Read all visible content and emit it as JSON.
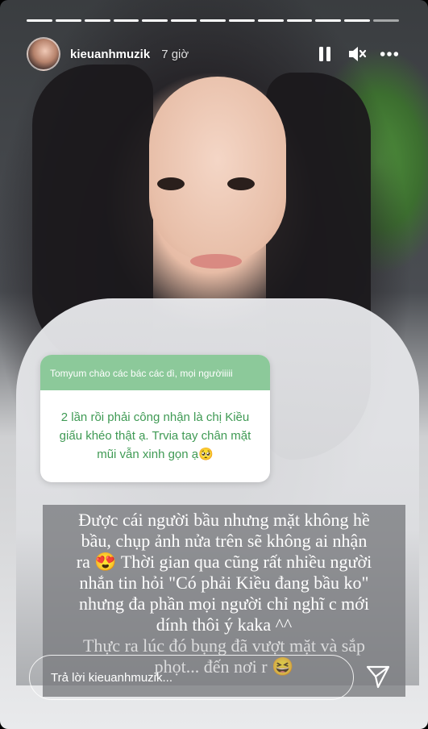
{
  "progress": {
    "segments": 13,
    "current": 13
  },
  "header": {
    "username": "kieuanhmuzik",
    "time": "7 giờ",
    "pause_icon": "pause-icon",
    "mute_icon": "volume-muted-icon",
    "more_icon": "more-icon"
  },
  "question_sticker": {
    "question": "Tomyum chào các bác các dì, mọi ngườiiiii",
    "answer": "2 lần rồi phải công nhận là chị Kiều giấu khéo thật ạ. Trvia tay chân mặt mũi vẫn xinh gọn ạ🥺",
    "header_color": "#8cc99a",
    "answer_color": "#3f9a54"
  },
  "caption": {
    "lines": [
      "Được cái người bầu nhưng mặt không hề",
      "bầu, chụp ảnh nửa trên sẽ không ai nhận",
      "ra 😍 Thời gian qua cũng rất nhiều người",
      "nhắn tin hỏi \"Có phải Kiều đang bầu ko\"",
      "nhưng đa phần mọi người chỉ nghĩ c mới",
      "dính thôi ý kaka ^^"
    ],
    "more_lines": [
      "Thực ra lúc đó bụng đã vượt mặt và sắp",
      "phọt... đến nơi r 😆"
    ]
  },
  "reply": {
    "placeholder": "Trả lời kieuanhmuzik..."
  },
  "send_icon": "send-icon"
}
